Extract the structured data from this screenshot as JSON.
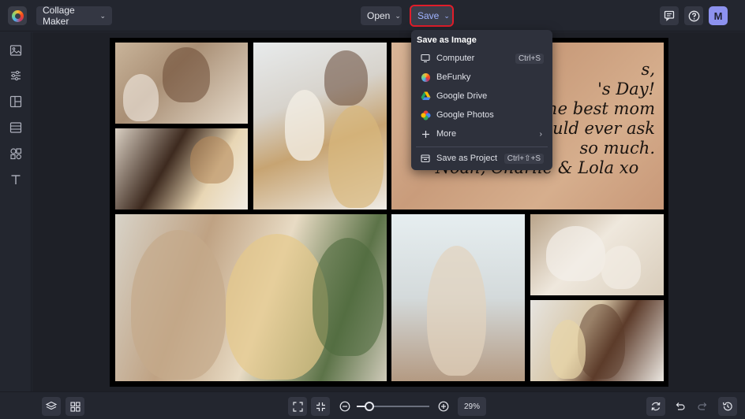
{
  "topbar": {
    "app_mode_label": "Collage Maker",
    "open_label": "Open",
    "save_label": "Save",
    "avatar_initial": "M"
  },
  "save_menu": {
    "header": "Save as Image",
    "items": [
      {
        "label": "Computer",
        "shortcut": "Ctrl+S",
        "icon": "monitor-icon"
      },
      {
        "label": "BeFunky",
        "shortcut": "",
        "icon": "befunky-icon"
      },
      {
        "label": "Google Drive",
        "shortcut": "",
        "icon": "google-drive-icon"
      },
      {
        "label": "Google Photos",
        "shortcut": "",
        "icon": "google-photos-icon"
      },
      {
        "label": "More",
        "shortcut": "",
        "icon": "plus-icon"
      }
    ],
    "project_item": {
      "label": "Save as Project",
      "shortcut": "Ctrl+⇧+S",
      "icon": "project-save-icon"
    }
  },
  "note_card": {
    "lines": [
      "s,",
      "'s Day!",
      "the best mom",
      "ould ever ask",
      "so much.",
      "- Noah, Charlie & Lola  xo"
    ]
  },
  "zoom": {
    "value_label": "29%",
    "level": 0.29
  },
  "colors": {
    "accent": "#9fb3ff",
    "highlight_box": "#e11d2a",
    "avatar_bg": "#8d92ef",
    "bg": "#23262f"
  }
}
